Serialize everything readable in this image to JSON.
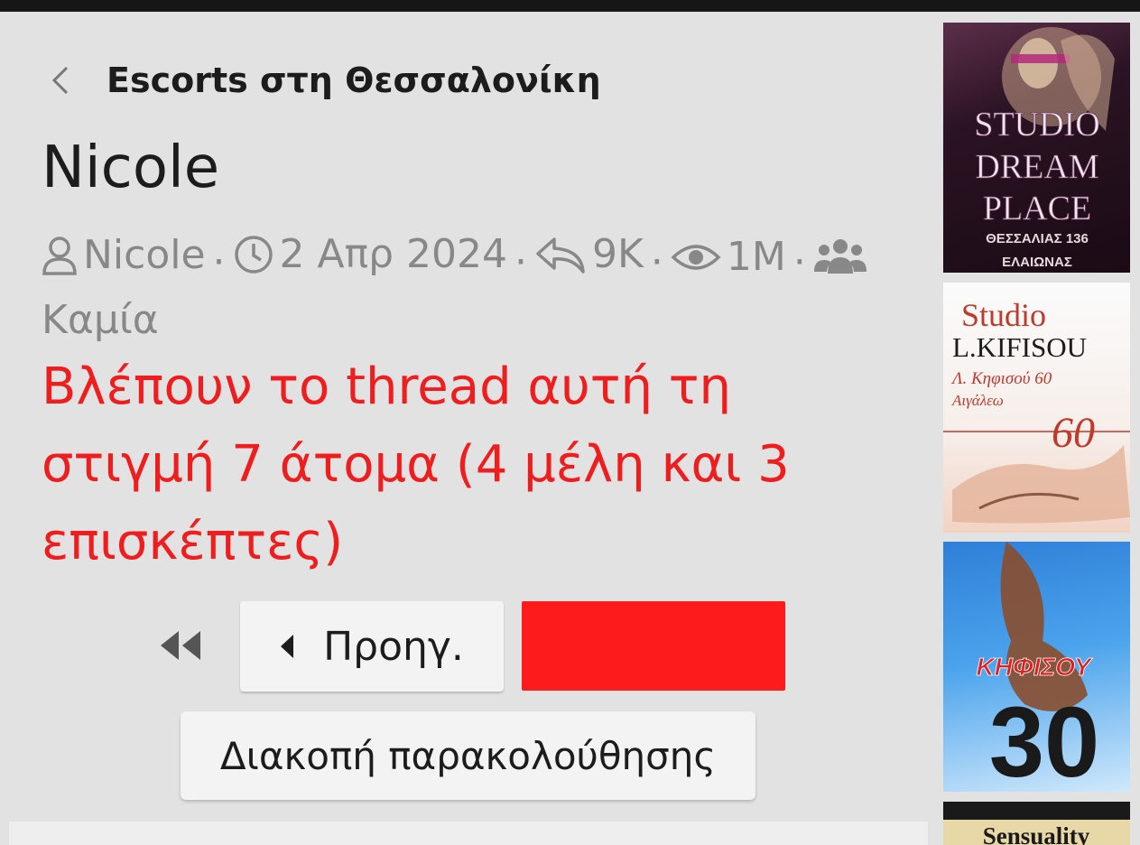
{
  "breadcrumb": {
    "label": "Escorts στη Θεσσαλονίκη"
  },
  "thread": {
    "title": "Nicole",
    "author": "Nicole",
    "date": "2 Απρ 2024",
    "replies": "9K",
    "views": "1M",
    "participants": "Καμία",
    "separator": "·"
  },
  "viewers_notice": "Βλέπουν το thread αυτή τη στιγμή 7 άτομα (4 μέλη και 3 επισκέπτες)",
  "pagination": {
    "prev_label": "Προηγ."
  },
  "watch": {
    "unwatch_label": "Διακοπή παρακολούθησης"
  },
  "ads": [
    {
      "lines": [
        "STUDIO",
        "DREAM",
        "PLACE",
        "ΘΕΣΣΑΛΙΑΣ 136",
        "ΕΛΑΙΩΝΑΣ"
      ]
    },
    {
      "lines": [
        "Studio",
        "L.KIFISOU",
        "Λ. Κηφισού 60",
        "Αιγάλεω",
        "60"
      ]
    },
    {
      "lines": [
        "ΚΗΦΙΣΟΥ",
        "30"
      ]
    },
    {
      "lines": [
        "Sensuality"
      ]
    }
  ],
  "colors": {
    "page_bg": "#e2e2e2",
    "topbar": "#161616",
    "notice_red": "#ef1d1d",
    "red_block": "#fd1b1b",
    "muted_text": "#888888",
    "button_bg": "#f3f3f3"
  }
}
